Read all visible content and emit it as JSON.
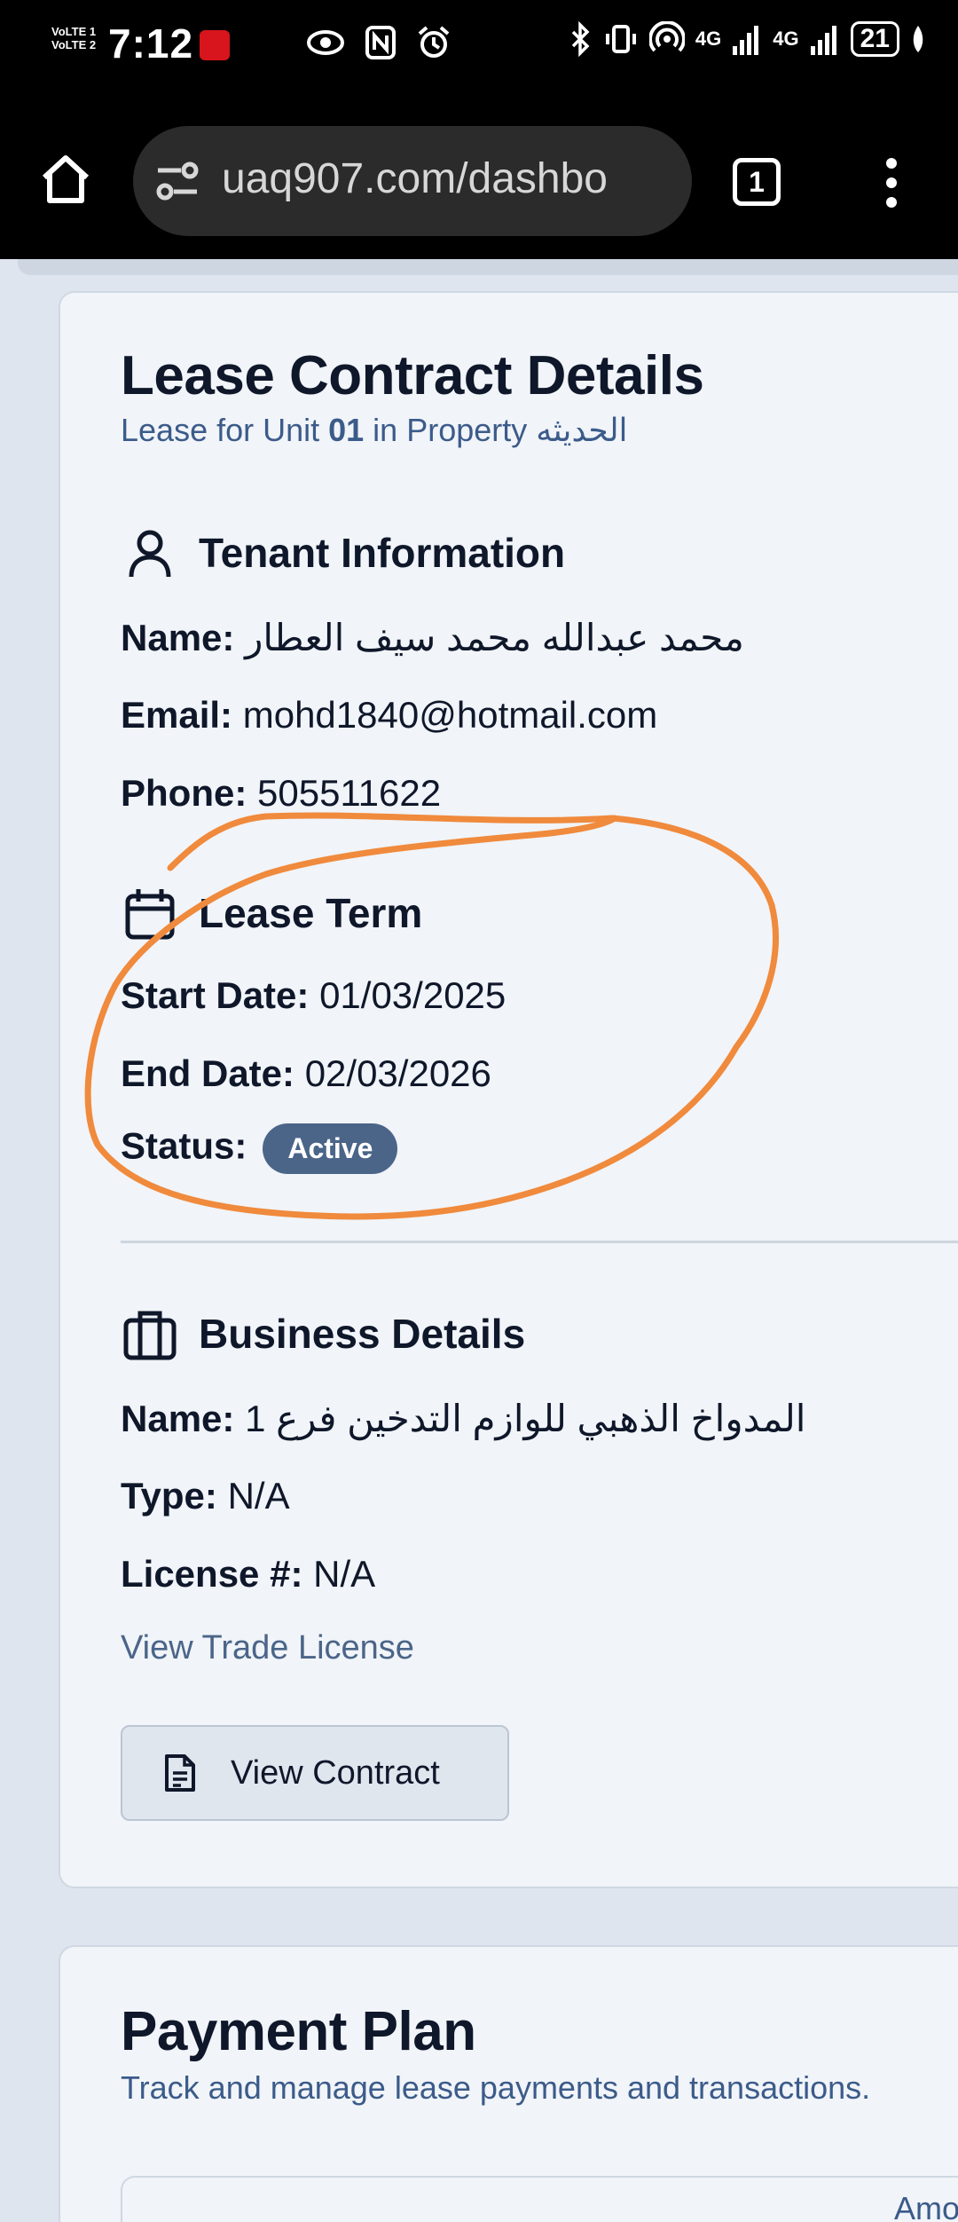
{
  "status_bar": {
    "volte_1": "VoLTE 1",
    "volte_2": "VoLTE 2",
    "time": "7:12",
    "network_1": "4G",
    "network_2": "4G",
    "battery": "21"
  },
  "browser": {
    "url": "uaq907.com/dashbo",
    "tab_count": "1"
  },
  "lease_card": {
    "title": "Lease Contract Details",
    "subtitle_prefix": "Lease for Unit ",
    "unit": "01",
    "subtitle_mid": " in Property ",
    "property": "الحديثه",
    "tenant": {
      "heading": "Tenant Information",
      "name_label": "Name:",
      "name": "محمد عبدالله محمد سيف العطار",
      "email_label": "Email:",
      "email": "mohd1840@hotmail.com",
      "phone_label": "Phone:",
      "phone": "505511622"
    },
    "lease_term": {
      "heading": "Lease Term",
      "start_label": "Start Date:",
      "start": "01/03/2025",
      "end_label": "End Date:",
      "end": "02/03/2026",
      "status_label": "Status:",
      "status": "Active"
    },
    "business": {
      "heading": "Business Details",
      "name_label": "Name:",
      "name": "المدواخ الذهبي للوازم التدخين فرع 1",
      "type_label": "Type:",
      "type": "N/A",
      "license_label": "License #:",
      "license": "N/A",
      "trade_license_link": "View Trade License"
    },
    "view_contract_button": "View Contract"
  },
  "payment_card": {
    "title": "Payment Plan",
    "subtitle": "Track and manage lease payments and transactions.",
    "table_header_partial": "Amo"
  },
  "colors": {
    "accent": "#4b6589",
    "annotation": "#f08a3c",
    "link": "#3b5b8a"
  }
}
